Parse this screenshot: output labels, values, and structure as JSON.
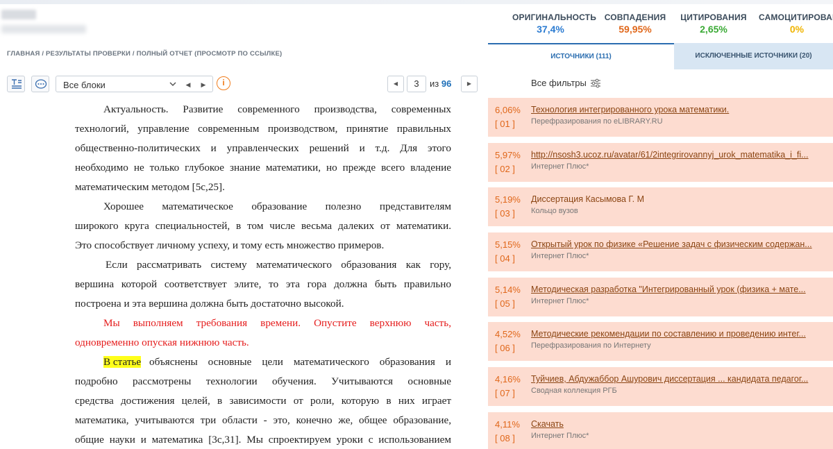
{
  "header": {
    "stats": [
      {
        "label": "ОРИГИНАЛЬНОСТЬ",
        "value": "37,4%",
        "color": "#2b7bd1"
      },
      {
        "label": "СОВПАДЕНИЯ",
        "value": "59,95%",
        "color": "#e0671a"
      },
      {
        "label": "ЦИТИРОВАНИЯ",
        "value": "2,65%",
        "color": "#3aaa35"
      },
      {
        "label": "САМОЦИТИРОВАНИЯ",
        "value": "0%",
        "color": "#f0b400"
      }
    ]
  },
  "breadcrumb": "ГЛАВНАЯ / РЕЗУЛЬТАТЫ ПРОВЕРКИ / ПОЛНЫЙ ОТЧЕТ (ПРОСМОТР ПО ССЫЛКЕ)",
  "toolbar": {
    "block_select": "Все блоки",
    "page_current": "3",
    "page_of": "из",
    "page_total": "96",
    "info_icon": "info-circle-icon"
  },
  "document": {
    "lines": [
      "Актуальность. Развитие современного производства, современных",
      "технологий, управление современным производством, принятие правильных",
      "общественно-политических и управленческих решений и т.д. Для этого",
      "необходимо не только глубокое знание математики, но прежде всего владение",
      "математическим методом [5с,25].",
      "Хорошее математическое образование полезно представителям",
      "широкого круга специальностей, в том числе весьма далеких от математики.",
      "Это способствует личному успеху, и тому есть множество примеров.",
      "Если рассматривать систему математического образования как гору,",
      "вершина которой соответствует элите, то эта гора должна быть правильно",
      "построена и эта вершина должна быть достаточно высокой.",
      "Мы выполняем требования времени. Опустите верхнюю часть,",
      "одновременно опуская нижнюю часть.",
      "В статье",
      "объяснены основные цели математического образования и",
      "подробно рассмотрены технологии обучения. Учитываются основные",
      "средства достижения целей, в зависимости от роли, которую в них играет",
      "математика, учитываются три области - это, конечно же, общее образование,",
      "общие науки и математика [3с,31]. Мы спроектируем уроки с использованием"
    ]
  },
  "right": {
    "tab_sources": "ИСТОЧНИКИ (111)",
    "tab_excluded": "ИСКЛЮЧЕННЫЕ ИСТОЧНИКИ (20)",
    "filters_label": "Все фильтры",
    "sources": [
      {
        "pct": "6,06%",
        "num": "[ 01 ]",
        "title": "Технология интегрированного урока математики.",
        "sub": "Перефразирования по eLIBRARY.RU"
      },
      {
        "pct": "5,97%",
        "num": "[ 02 ]",
        "title": "http://nsosh3.ucoz.ru/avatar/61/2integrirovannyj_urok_matematika_i_fi...",
        "sub": "Интернет Плюс*"
      },
      {
        "pct": "5,19%",
        "num": "[ 03 ]",
        "title": "Диссертация Касымова Г. М",
        "sub": "Кольцо вузов"
      },
      {
        "pct": "5,15%",
        "num": "[ 04 ]",
        "title": "Открытый урок по физике «Решение задач с физическим содержан...",
        "sub": "Интернет Плюс*"
      },
      {
        "pct": "5,14%",
        "num": "[ 05 ]",
        "title": "Методическая разработка \"Интегрированный урок (физика + мате...",
        "sub": "Интернет Плюс*"
      },
      {
        "pct": "4,52%",
        "num": "[ 06 ]",
        "title": "Методические рекомендации по составлению и проведению интег...",
        "sub": "Перефразирования по Интернету"
      },
      {
        "pct": "4,16%",
        "num": "[ 07 ]",
        "title": "Туйчиев, Абдужаббор Ашурович диссертация ... кандидата педагог...",
        "sub": "Сводная коллекция РГБ"
      },
      {
        "pct": "4,11%",
        "num": "[ 08 ]",
        "title": "Скачать",
        "sub": "Интернет Плюс*"
      }
    ]
  }
}
